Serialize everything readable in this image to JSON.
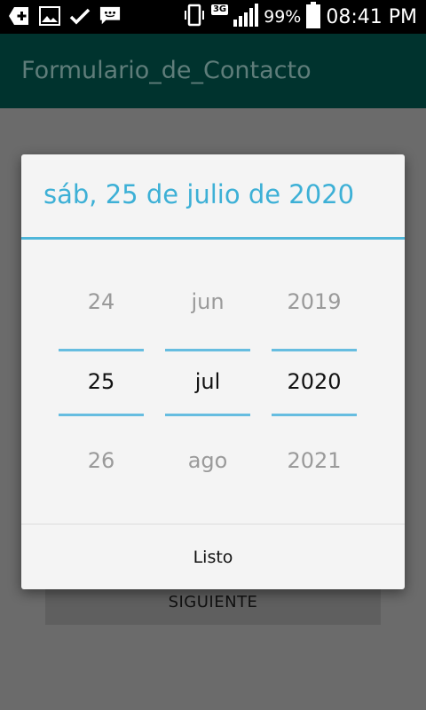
{
  "status_bar": {
    "battery_percent": "99%",
    "time": "08:41 PM",
    "network_type": "3G"
  },
  "app_bar": {
    "title": "Formulario_de_Contacto"
  },
  "background": {
    "next_button_label": "SIGUIENTE"
  },
  "dialog": {
    "title": "sáb, 25 de julio de 2020",
    "day_picker": {
      "prev": "24",
      "selected": "25",
      "next": "26"
    },
    "month_picker": {
      "prev": "jun",
      "selected": "jul",
      "next": "ago"
    },
    "year_picker": {
      "prev": "2019",
      "selected": "2020",
      "next": "2021"
    },
    "done_label": "Listo"
  },
  "colors": {
    "accent": "#3db0d6",
    "app_bar": "#00332e",
    "scrim": "#6b6b6b"
  }
}
